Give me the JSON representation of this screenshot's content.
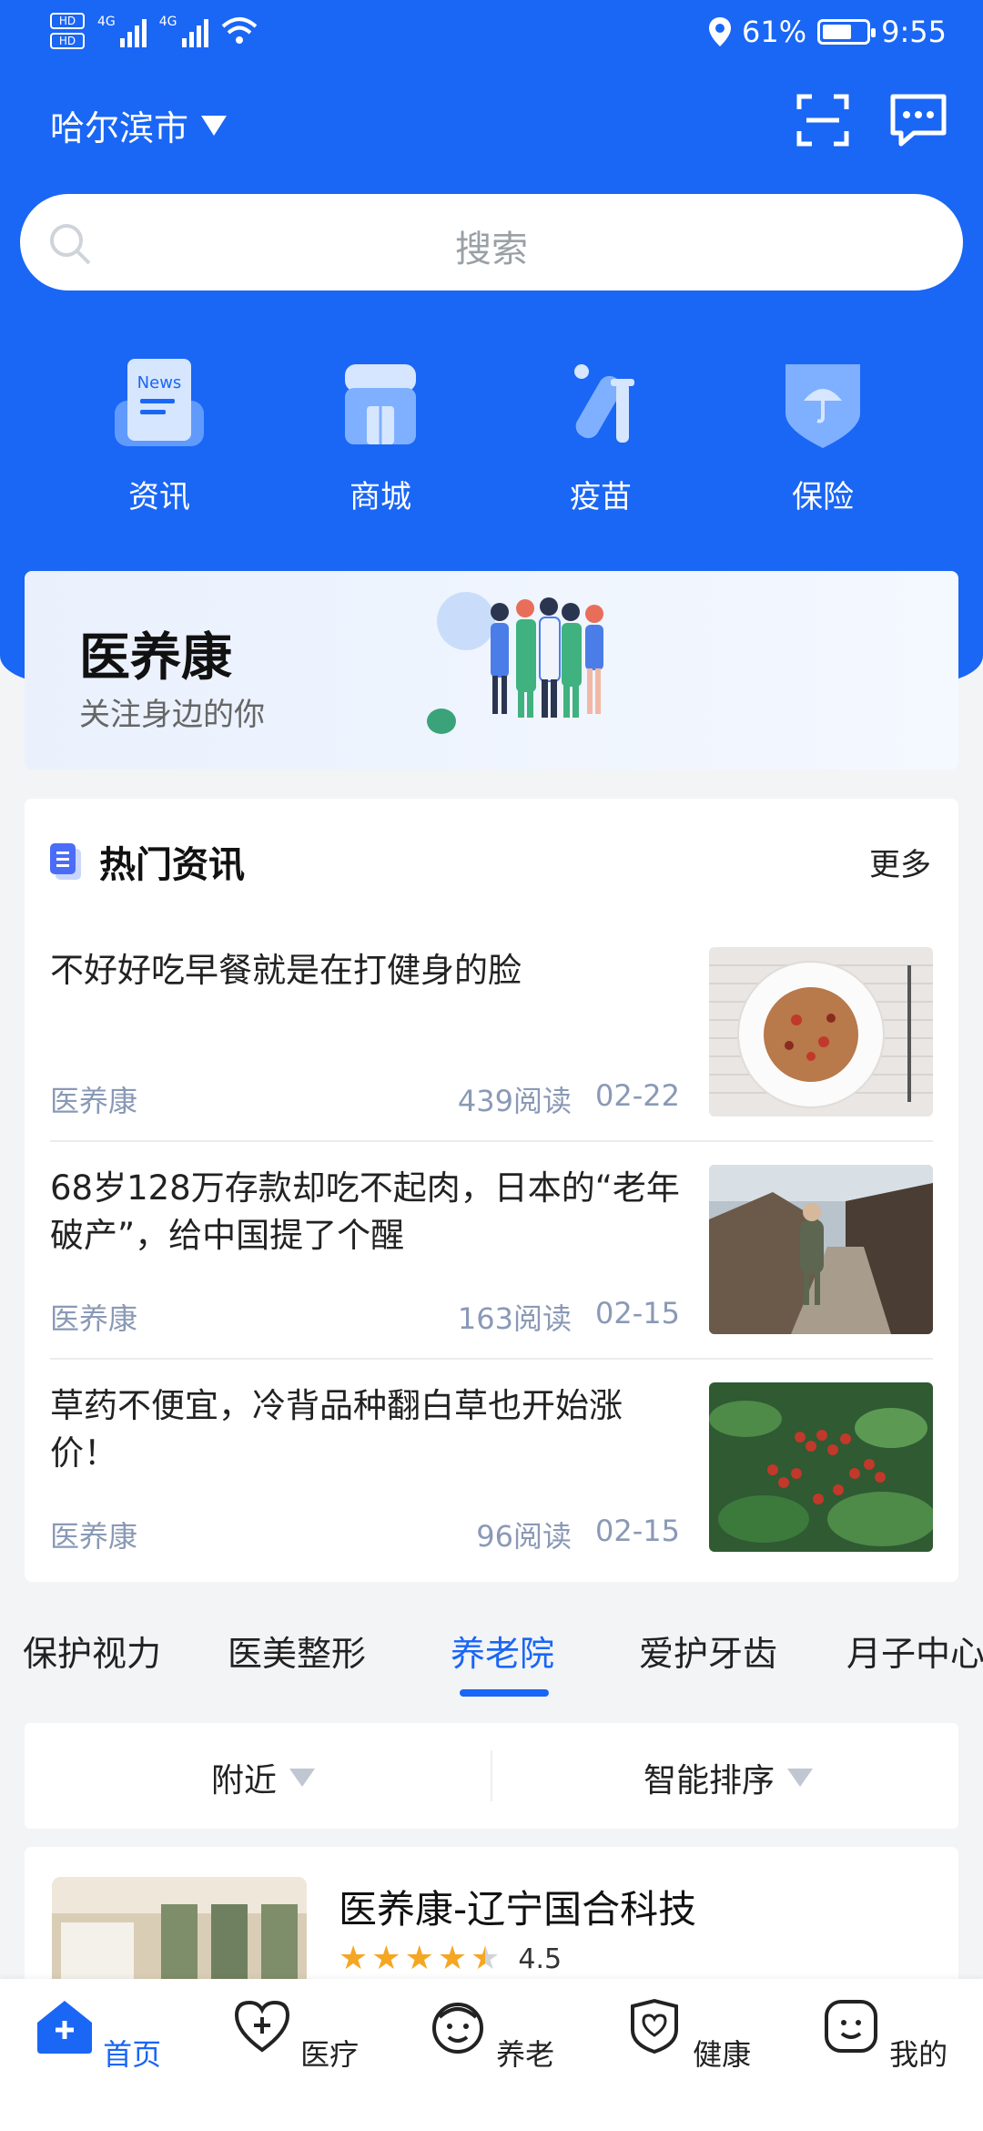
{
  "status_bar": {
    "battery": "61%",
    "time": "9:55",
    "network": "4G"
  },
  "header": {
    "city": "哈尔滨市"
  },
  "search": {
    "placeholder": "搜索"
  },
  "quick_actions": [
    {
      "label": "资讯",
      "icon": "news-icon"
    },
    {
      "label": "商城",
      "icon": "store-icon"
    },
    {
      "label": "疫苗",
      "icon": "vaccine-icon"
    },
    {
      "label": "保险",
      "icon": "insurance-icon"
    }
  ],
  "banner": {
    "title": "医养康",
    "subtitle": "关注身边的你"
  },
  "news": {
    "title": "热门资讯",
    "more": "更多",
    "items": [
      {
        "title": "不好好吃早餐就是在打健身的脸",
        "source": "医养康",
        "reads": "439阅读",
        "date": "02-22"
      },
      {
        "title": "68岁128万存款却吃不起肉，日本的“老年破产”，给中国提了个醒",
        "source": "医养康",
        "reads": "163阅读",
        "date": "02-15"
      },
      {
        "title": "草药不便宜，冷背品种翻白草也开始涨价！",
        "source": "医养康",
        "reads": "96阅读",
        "date": "02-15"
      }
    ]
  },
  "category_tabs": [
    "保护视力",
    "医美整形",
    "养老院",
    "爱护牙齿",
    "月子中心"
  ],
  "active_tab": "养老院",
  "filters": {
    "nearby": "附近",
    "sort": "智能排序"
  },
  "listing": {
    "name": "医养康-辽宁国合科技",
    "rating": "4.5",
    "rating_value": 4.5
  },
  "bottom_nav": [
    {
      "label": "首页",
      "icon": "home-icon"
    },
    {
      "label": "医疗",
      "icon": "medical-icon"
    },
    {
      "label": "养老",
      "icon": "elderly-icon"
    },
    {
      "label": "健康",
      "icon": "health-icon"
    },
    {
      "label": "我的",
      "icon": "profile-icon"
    }
  ],
  "colors": {
    "primary": "#1a66f5",
    "meta": "#8a99b6",
    "star": "#f5a623"
  }
}
